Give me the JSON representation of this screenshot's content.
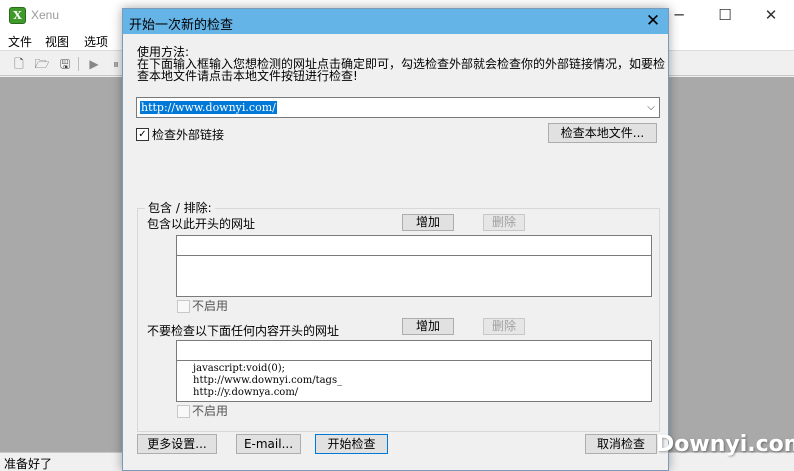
{
  "app": {
    "title": "Xenu",
    "icon": "xenu-app-icon",
    "icon_glyph": "X",
    "window_controls": {
      "minimize": "─",
      "maximize": "☐",
      "close": "✕"
    }
  },
  "menubar": {
    "file": "文件",
    "view": "视图",
    "options": "选项"
  },
  "toolbar": {
    "items": [
      {
        "icon": "new-document-icon",
        "glyph": "🗋"
      },
      {
        "icon": "open-folder-icon",
        "glyph": "🗁"
      },
      {
        "icon": "save-icon",
        "glyph": "🖫"
      },
      {
        "icon": "run-icon",
        "glyph": "▶"
      },
      {
        "icon": "pause-icon",
        "glyph": "⏸"
      }
    ]
  },
  "status_bar": {
    "text": "准备好了"
  },
  "dialog": {
    "title": "开始一次新的检查",
    "close_glyph": "✕",
    "usage_title": "使用方法:",
    "usage_line1": "在下面输入框输入您想检测的网址点击确定即可，勾选检查外部就会检查你的外部链接情况，如要检",
    "usage_line2": "查本地文件请点击本地文件按钮进行检查!",
    "url_value": "http://www.downyi.com/",
    "url_dropdown_glyph": "⌵",
    "check_external_label": "检查外部链接",
    "check_external_checked": true,
    "check_mark": "✓",
    "check_local_button": "检查本地文件...",
    "filter_group_label": "包含 / 排除:",
    "include": {
      "label": "包含以此开头的网址",
      "add_button": "增加",
      "delete_button": "删除",
      "input_value": "",
      "entries": [],
      "disable_label": "不启用",
      "disable_checked": false
    },
    "exclude": {
      "label": "不要检查以下面任何内容开头的网址",
      "add_button": "增加",
      "delete_button": "删除",
      "input_value": "",
      "entries": [
        "javascript:void(0);",
        "http://www.downyi.com/tags_",
        "http://y.downya.com/"
      ],
      "disable_label": "不启用",
      "disable_checked": false
    },
    "buttons": {
      "more_settings": "更多设置...",
      "email": "E-mail...",
      "start_check": "开始检查",
      "cancel_check": "取消检查"
    }
  },
  "watermark": {
    "text": "Downyi.com"
  },
  "colors": {
    "dialog_titlebar": "#64b4e8",
    "selection": "#0078d7",
    "workarea": "#a9a9a9",
    "window_bg": "#f0f0f0"
  }
}
